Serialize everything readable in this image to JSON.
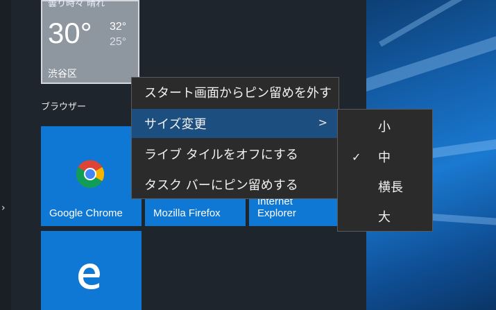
{
  "weather": {
    "top_text": "曇り時々 晴れ",
    "temperature": "30°",
    "high": "32°",
    "low": "25°",
    "location": "渋谷区"
  },
  "group": {
    "title": "ブラウザー"
  },
  "tiles": [
    {
      "label": "Google Chrome"
    },
    {
      "label": "Mozilla Firefox"
    },
    {
      "label_line1": "Internet",
      "label_line2": "Explorer"
    }
  ],
  "context_menu": {
    "items": [
      {
        "label": "スタート画面からピン留めを外す"
      },
      {
        "label": "サイズ変更",
        "submenu_arrow": ">"
      },
      {
        "label": "ライブ タイルをオフにする"
      },
      {
        "label": "タスク バーにピン留めする"
      }
    ]
  },
  "size_submenu": {
    "checkmark": "✓",
    "items": [
      {
        "label": "小"
      },
      {
        "label": "中",
        "checked": true
      },
      {
        "label": "横長"
      },
      {
        "label": "大"
      }
    ]
  },
  "colors": {
    "tile_blue": "#0f78d4",
    "menu_bg": "#2b2b2b",
    "menu_highlight": "#1d4e80",
    "start_bg": "#1f252c"
  },
  "icons": {
    "chrome": "chrome-logo-icon",
    "edge": "edge-logo-icon",
    "expand": "chevron-right-icon"
  }
}
